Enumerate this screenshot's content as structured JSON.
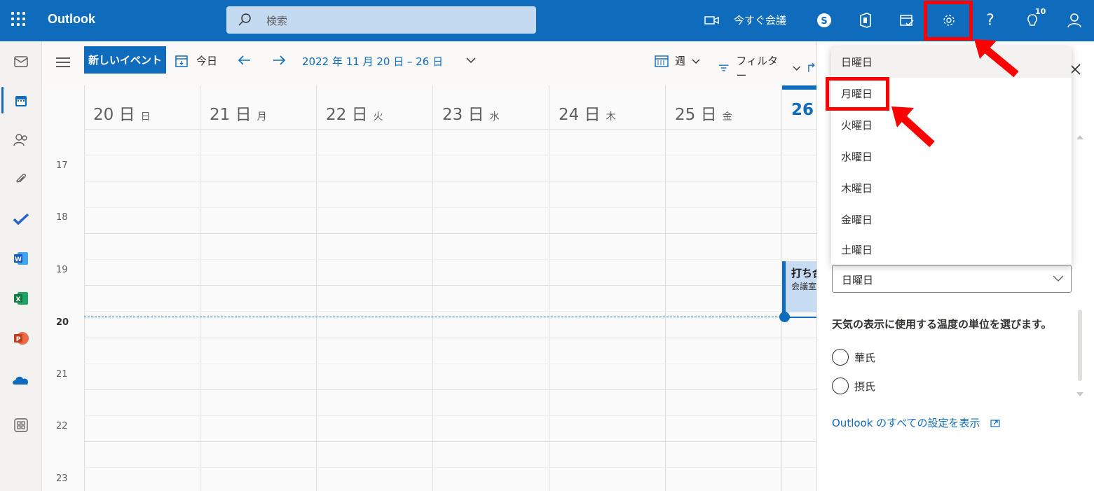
{
  "app": {
    "title": "Outlook"
  },
  "search": {
    "placeholder": "検索"
  },
  "topbar": {
    "meet_now": "今すぐ会議",
    "help": "?",
    "badge_count": "10"
  },
  "toolbar": {
    "new_event": "新しいイベント",
    "today": "今日",
    "date_range": "2022 年 11 月 20 日 – 26 日",
    "view": "週",
    "filter": "フィルター"
  },
  "calendar": {
    "days": [
      {
        "num": "20 日",
        "dow": "日"
      },
      {
        "num": "21 日",
        "dow": "月"
      },
      {
        "num": "22 日",
        "dow": "火"
      },
      {
        "num": "23 日",
        "dow": "水"
      },
      {
        "num": "24 日",
        "dow": "木"
      },
      {
        "num": "25 日",
        "dow": "金"
      },
      {
        "num": "26",
        "dow": ""
      }
    ],
    "hours": [
      "17",
      "18",
      "19",
      "20",
      "21",
      "22",
      "23"
    ],
    "event": {
      "title": "打ち合",
      "location": "会議室"
    }
  },
  "settings": {
    "first_day_options": [
      "日曜日",
      "月曜日",
      "火曜日",
      "水曜日",
      "木曜日",
      "金曜日",
      "土曜日"
    ],
    "first_day_selected": "日曜日",
    "weather_label": "天気の表示に使用する温度の単位を選びます。",
    "units": [
      "華氏",
      "摂氏"
    ],
    "all_settings_link": "Outlook のすべての設定を表示"
  },
  "colors": {
    "brand": "#0f6cbd",
    "highlight": "#ff0000"
  }
}
